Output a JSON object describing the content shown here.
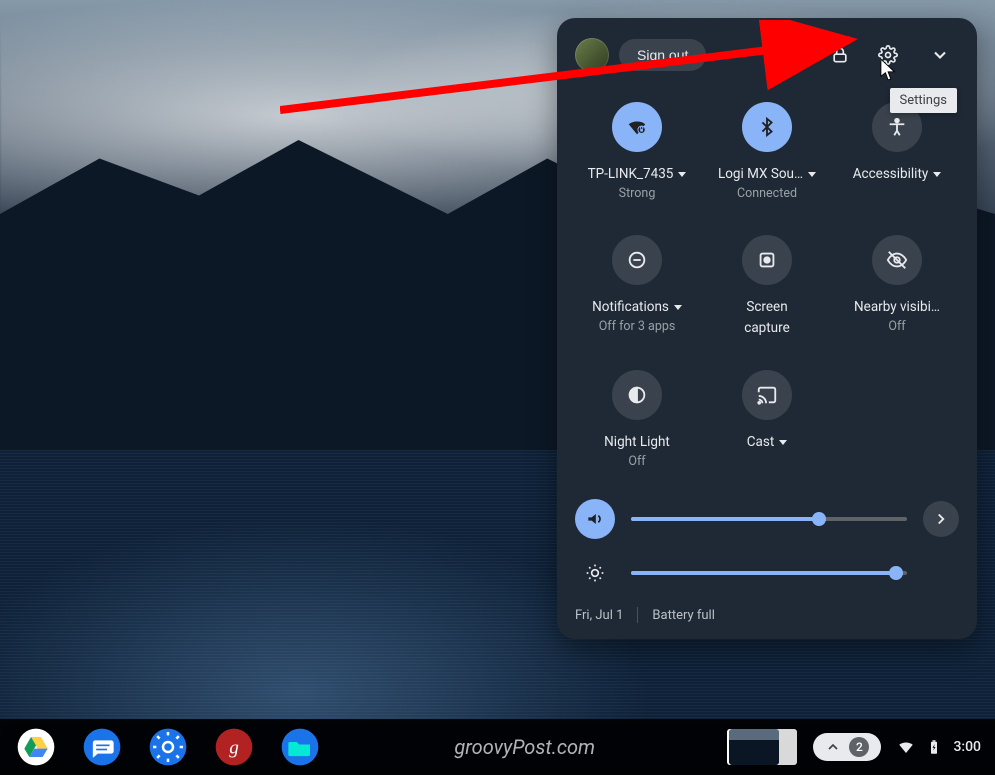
{
  "header": {
    "signout_label": "Sign out",
    "tooltip": "Settings"
  },
  "tiles": {
    "wifi": {
      "label": "TP-LINK_7435",
      "sub": "Strong",
      "active": true,
      "has_caret": true
    },
    "bluetooth": {
      "label": "Logi MX Sou…",
      "sub": "Connected",
      "active": true,
      "has_caret": true
    },
    "a11y": {
      "label": "Accessibility",
      "sub": "",
      "active": false,
      "has_caret": true
    },
    "notif": {
      "label": "Notifications",
      "sub": "Off for 3 apps",
      "active": false,
      "has_caret": true
    },
    "screen": {
      "label": "Screen capture",
      "sub": "",
      "active": false,
      "has_caret": false,
      "multiline": true,
      "label1": "Screen",
      "label2": "capture"
    },
    "nearby": {
      "label": "Nearby visibi…",
      "sub": "Off",
      "active": false,
      "has_caret": false
    },
    "nightlight": {
      "label": "Night Light",
      "sub": "Off",
      "active": false,
      "has_caret": false
    },
    "cast": {
      "label": "Cast",
      "sub": "",
      "active": false,
      "has_caret": true
    }
  },
  "sliders": {
    "volume_percent": 68,
    "brightness_percent": 96
  },
  "footer": {
    "date": "Fri, Jul 1",
    "battery": "Battery full"
  },
  "shelf": {
    "watermark": "groovyPost.com",
    "notif_count": "2",
    "time": "3:00"
  }
}
